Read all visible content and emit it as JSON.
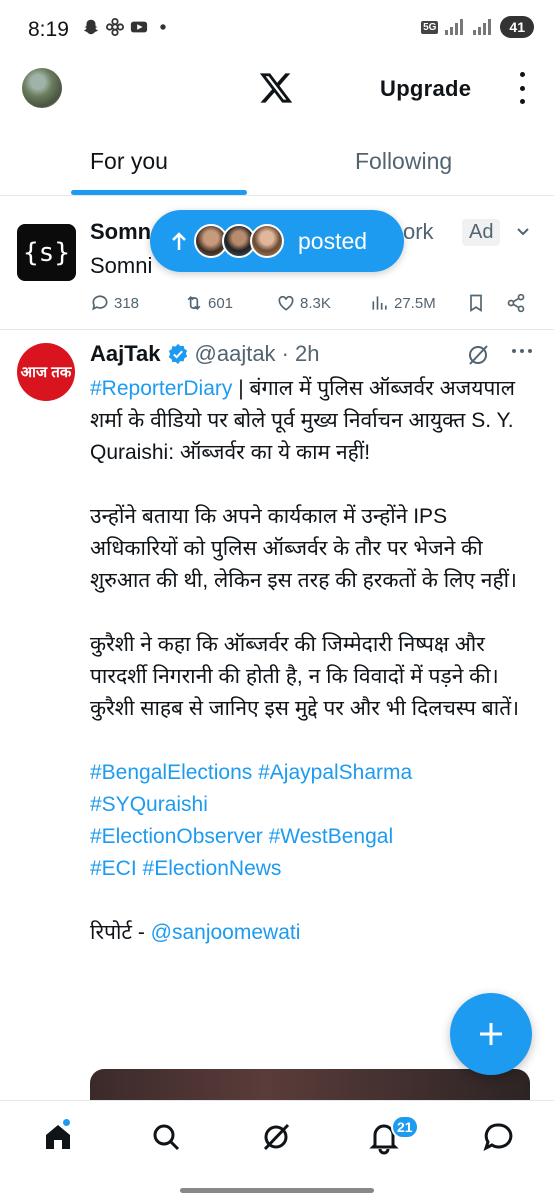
{
  "status_bar": {
    "time": "8:19",
    "network": "5G",
    "battery": "41"
  },
  "top_bar": {
    "upgrade_label": "Upgrade"
  },
  "tabs": [
    {
      "label": "For you",
      "active": true
    },
    {
      "label": "Following",
      "active": false
    }
  ],
  "ad_tweet": {
    "name_visible": "Somn",
    "name_tail": "ork",
    "subtitle_visible": "Somni",
    "logo_text": "{s}",
    "badge": "Ad",
    "replies": "318",
    "reposts": "601",
    "likes": "8.3K",
    "views": "27.5M"
  },
  "posted_pill": {
    "label": "posted"
  },
  "tweet": {
    "name": "AajTak",
    "handle": "@aajtak",
    "time": "· 2h",
    "avatar_text": "आज तक",
    "para1_tag": "#ReporterDiary",
    "para1_text": " | बंगाल में पुलिस ऑब्जर्वर अजयपाल शर्मा के वीडियो पर बोले पूर्व मुख्य निर्वाचन आयुक्त S. Y. Quraishi: ऑब्जर्वर का ये काम नहीं!",
    "para2": "उन्होंने बताया कि अपने कार्यकाल में उन्होंने IPS अधिकारियों को पुलिस ऑब्जर्वर के तौर पर भेजने की शुरुआत की थी, लेकिन इस तरह की हरकतों के लिए नहीं।",
    "para3": "कुरैशी ने कहा कि ऑब्जर्वर की जिम्मेदारी निष्पक्ष और पारदर्शी निगरानी की होती है, न कि विवादों में पड़ने की। कुरैशी साहब से जानिए इस मुद्दे पर और भी दिलचस्प बातें।",
    "hashtags": [
      "#BengalElections",
      "#AjaypalSharma",
      "#SYQuraishi",
      "#ElectionObserver",
      "#WestBengal",
      "#ECI",
      "#ElectionNews"
    ],
    "report_prefix": "रिपोर्ट - ",
    "report_link": "@sanjoomewati"
  },
  "bottom_nav": {
    "notifications_count": "21"
  },
  "colors": {
    "accent": "#1d9bf0",
    "text_primary": "#0f1419",
    "text_secondary": "#536471",
    "aajtak_red": "#d9141e"
  }
}
